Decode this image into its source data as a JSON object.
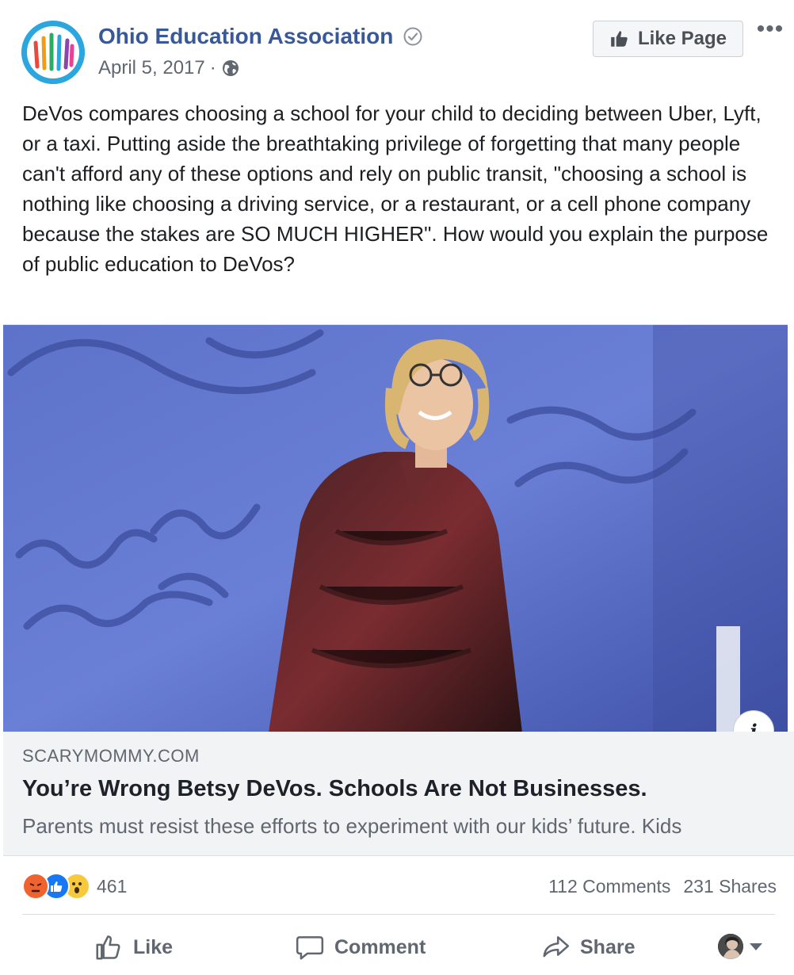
{
  "post": {
    "page_name": "Ohio Education Association",
    "date": "April 5, 2017",
    "date_separator": "·",
    "like_page_label": "Like Page",
    "more_label": "•••",
    "text": "DeVos compares choosing a school for your child to deciding between Uber, Lyft, or a taxi. Putting aside the breathtaking privilege of forgetting that many people can't afford any of these options and rely on public transit, \"choosing a school is nothing like choosing a driving service, or a restaurant, or a cell phone company because the stakes are SO MUCH HIGHER\". How would you explain the purpose of public education to DeVos?"
  },
  "link": {
    "domain": "SCARYMOMMY.COM",
    "title": "You’re Wrong Betsy DeVos. Schools Are Not Businesses.",
    "description": "Parents must resist these efforts to experiment with our kids’ future. Kids",
    "info_label": "i"
  },
  "engagement": {
    "reaction_count": "461",
    "reactions": [
      "angry",
      "like",
      "wow"
    ],
    "comments": "112 Comments",
    "shares": "231 Shares"
  },
  "actions": {
    "like": "Like",
    "comment": "Comment",
    "share": "Share"
  },
  "colors": {
    "brand_link": "#385898",
    "secondary_text": "#606770",
    "preview_bg": "#f2f3f5",
    "like_blue": "#1877f2",
    "angry_orange": "#f0622e",
    "wow_yellow": "#f7c93c"
  }
}
